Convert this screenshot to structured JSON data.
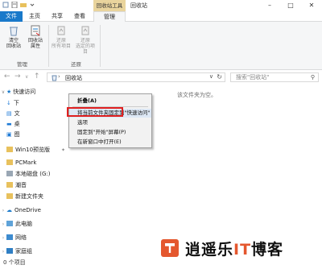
{
  "title_bar": {
    "contextual_tab_title": "回收站工具",
    "window_title": "回收站",
    "min_glyph": "–",
    "max_glyph": "□",
    "close_glyph": "✕"
  },
  "ribbon_tabs": {
    "file": "文件",
    "home": "主页",
    "share": "共享",
    "view": "查看",
    "manage": "管理"
  },
  "ribbon": {
    "empty_recycle_bin": "清空\n回收站",
    "recycle_bin_properties": "回收站\n属性",
    "restore_all": "还原\n所有项目",
    "restore_selected": "还原\n选定的项目",
    "group_manage": "管理",
    "group_restore": "还原"
  },
  "address": {
    "location": "回收站",
    "search_placeholder": "搜索\"回收站\""
  },
  "nav_pane": {
    "quick_access": "快速访问",
    "items": [
      {
        "label": "下",
        "color": "#1e7ad6"
      },
      {
        "label": "文",
        "color": "#1e7ad6"
      },
      {
        "label": "桌",
        "color": "#1e7ad6"
      },
      {
        "label": "图",
        "color": "#1e7ad6"
      }
    ],
    "folders": [
      "Win10预览版",
      "PCMark",
      "本地磁盘 (G:)",
      "潮音",
      "新建文件夹"
    ],
    "onedrive": "OneDrive",
    "this_pc": "此电脑",
    "network": "网络",
    "homegroup": "家庭组"
  },
  "content": {
    "empty_message": "该文件夹为空。"
  },
  "context_menu": {
    "items": [
      "折叠(A)",
      "将当前文件夹固定到\"快速访问\"",
      "选项",
      "固定到\"开始\"屏幕(P)",
      "在新窗口中打开(E)"
    ]
  },
  "status_bar": {
    "item_count": "0 个项目"
  },
  "watermark": {
    "text_a": "逍遥乐",
    "text_b": "IT",
    "text_c": "博客"
  },
  "colors": {
    "accent_blue": "#1979ca",
    "contextual_tab": "#e9d49d",
    "highlight_red": "#e02020"
  }
}
